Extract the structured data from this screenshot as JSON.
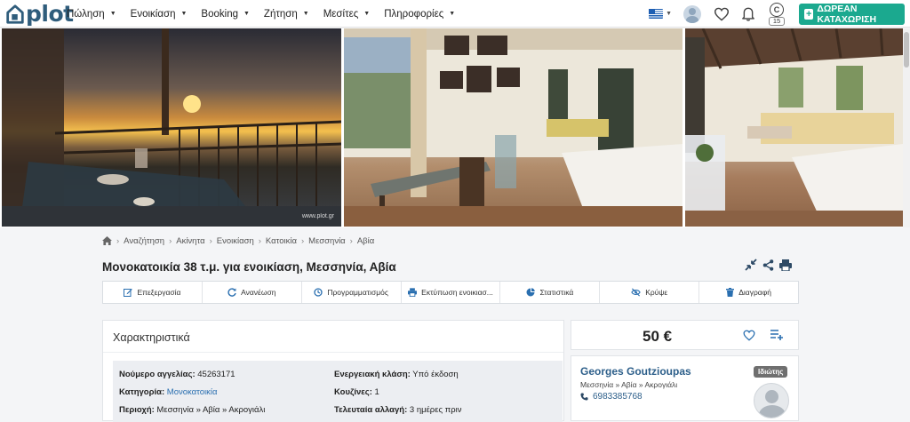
{
  "header": {
    "logo_text": "plot",
    "nav": [
      {
        "label": "Πώληση"
      },
      {
        "label": "Ενοικίαση"
      },
      {
        "label": "Booking"
      },
      {
        "label": "Ζήτηση"
      },
      {
        "label": "Μεσίτες"
      },
      {
        "label": "Πληροφορίες"
      }
    ],
    "credits_count": "15",
    "credits_letter": "C",
    "cta_label": "ΔΩΡΕΑΝ ΚΑΤΑΧΩΡΙΣΗ"
  },
  "gallery": {
    "watermark": "www.plot.gr",
    "photos": [
      "balcony-sunset-photo",
      "living-room-photo",
      "bedroom-photo"
    ]
  },
  "breadcrumb": [
    "Αναζήτηση",
    "Ακίνητα",
    "Ενοικίαση",
    "Κατοικία",
    "Μεσσηνία",
    "Αβία"
  ],
  "listing": {
    "title": "Μονοκατοικία 38 τ.μ. για ενοικίαση, Μεσσηνία, Αβία"
  },
  "toolbar": {
    "edit": "Επεξεργασία",
    "refresh": "Ανανέωση",
    "schedule": "Προγραμματισμός",
    "print": "Εκτύπωση ενοικιασ...",
    "stats": "Στατιστικά",
    "hide": "Κρύψε",
    "delete": "Διαγραφή"
  },
  "features": {
    "heading": "Χαρακτηριστικά",
    "ad_number_label": "Νούμερο αγγελίας:",
    "ad_number_value": "45263171",
    "category_label": "Κατηγορία:",
    "category_value": "Μονοκατοικία",
    "area_label": "Περιοχή:",
    "area_value": "Μεσσηνία » Αβία » Ακρογιάλι",
    "energy_label": "Ενεργειακή κλάση:",
    "energy_value": "Υπό έκδοση",
    "kitchens_label": "Κουζίνες:",
    "kitchens_value": "1",
    "last_change_label": "Τελευταία αλλαγή:",
    "last_change_value": "3 ημέρες πριν"
  },
  "price": {
    "value": "50 €"
  },
  "agent": {
    "name": "Georges Goutzioupas",
    "location": "Μεσσηνία » Αβία » Ακρογιάλι",
    "phone": "6983385768",
    "badge": "Ιδιώτης"
  },
  "colors": {
    "brand": "#2f5d7c",
    "cta": "#1ba98f",
    "link": "#2a6fb0"
  }
}
